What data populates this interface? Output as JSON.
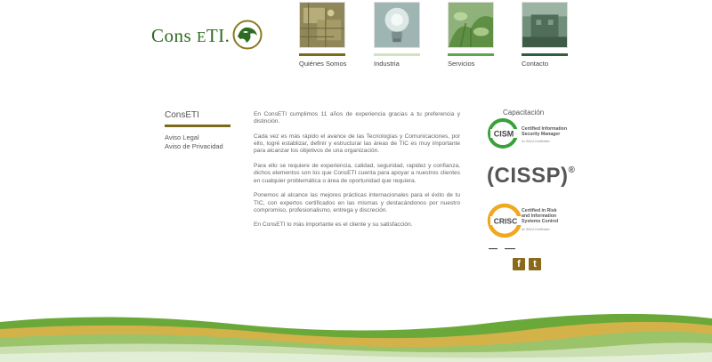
{
  "brand": {
    "name": "ConsETI",
    "logo_part1": "Cons",
    "logo_part2": "E",
    "logo_part3": "TI."
  },
  "nav": {
    "items": [
      {
        "label": "Quiénes Somos",
        "bar_color": "#7a6a1a"
      },
      {
        "label": "Industria",
        "bar_color": "#cfe3c0"
      },
      {
        "label": "Servicios",
        "bar_color": "#5aa84a"
      },
      {
        "label": "Contacto",
        "bar_color": "#2f5f3a"
      }
    ]
  },
  "sidebar": {
    "title": "ConsETI",
    "links": [
      "Aviso Legal",
      "Aviso de Privacidad"
    ]
  },
  "content": {
    "paragraphs": [
      "En ConsETI cumplimos 11 años de experiencia gracias a tu preferencia y distinción.",
      "Cada vez es más rápido el avance de las Tecnologías y Comunicaciones, por ello, logré establizar, definir y estructurar las áreas de TIC es muy importante para alcanzar los objetivos de una organización.",
      "Para ello se requiere de experiencia, calidad, seguridad, rapidez y confianza, dichos elementos son los que ConsETI cuenta para apoyar a nuestros clientes en cualquier problemática o área de oportunidad que requiera.",
      "Ponemos al alcance las mejores prácticas internacionales para el éxito de tu TIC, con expertos certificados en las mismas y destacándonos por nuestro compromiso, profesionalismo, entrega y discreción.",
      "En ConsETI lo más importante es el cliente y su satisfacción."
    ]
  },
  "training": {
    "title": "Capacitación",
    "cism": {
      "abbr": "CISM",
      "line1": "Certified Information",
      "line2": "Security Manager",
      "sub": "An ISACA Certification"
    },
    "cissp": {
      "label": "(CISSP)",
      "mark": "®"
    },
    "crisc": {
      "abbr": "CRISC",
      "line1": "Certified in Risk",
      "line2": "and Information",
      "line3": "Systems Control",
      "sub": "An ISACA Certification"
    }
  },
  "social": {
    "facebook": "f",
    "twitter": "t"
  },
  "colors": {
    "olive": "#7a6a1a",
    "green": "#2d6b1f",
    "cism_green": "#3aa03a",
    "crisc_orange": "#f0a81e",
    "social": "#8a6a1a"
  }
}
